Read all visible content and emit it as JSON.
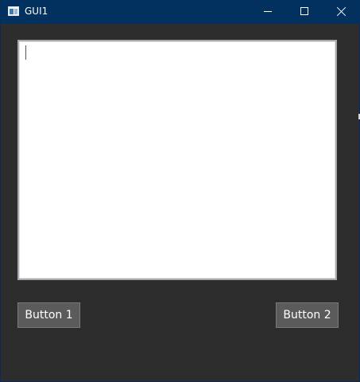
{
  "window": {
    "title": "GUI1",
    "controls": {
      "minimize_icon": "minimize-icon",
      "maximize_icon": "maximize-icon",
      "close_icon": "close-icon"
    },
    "colors": {
      "titlebar": "#02305f",
      "background": "#2d2d2d",
      "button": "#5b5b5b"
    }
  },
  "editor": {
    "value": ""
  },
  "buttons": {
    "button1_label": "Button 1",
    "button2_label": "Button 2"
  }
}
